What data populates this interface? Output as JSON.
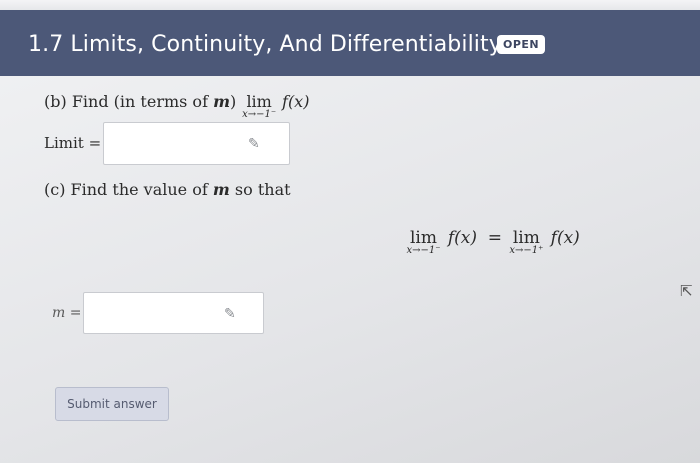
{
  "header": {
    "title": "1.7 Limits, Continuity, And Differentiability",
    "badge": "OPEN"
  },
  "part_b": {
    "label": "(b) Find (in terms of",
    "variable": "m",
    "close": ")",
    "lim_word": "lim",
    "lim_sub": "x→−1⁻",
    "function": "f(x)",
    "limit_label": "Limit =",
    "limit_value": ""
  },
  "part_c": {
    "text_before": "(c) Find the value of",
    "variable": "m",
    "text_after": "so that",
    "eq": {
      "lim_word": "lim",
      "left_sub": "x→−1⁻",
      "left_function": "f(x)",
      "equals": "=",
      "right_sub": "x→−1⁺",
      "right_function": "f(x)"
    },
    "m_label": "m =",
    "m_value": ""
  },
  "submit": {
    "label": "Submit answer"
  },
  "icons": {
    "pencil": "pencil-icon",
    "cursor": "mouse-cursor-icon"
  }
}
